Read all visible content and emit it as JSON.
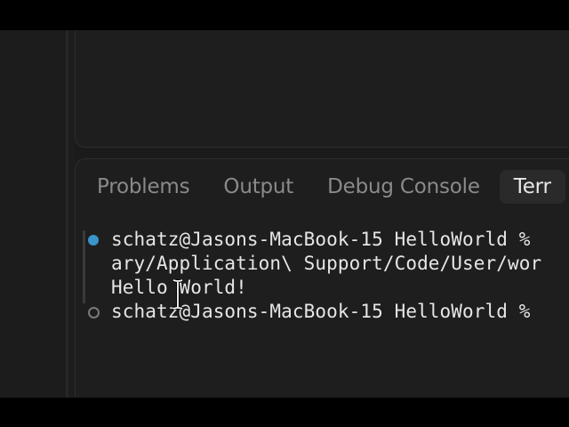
{
  "panel": {
    "tabs": [
      {
        "label": "Problems"
      },
      {
        "label": "Output"
      },
      {
        "label": "Debug Console"
      },
      {
        "label": "Terr"
      }
    ]
  },
  "terminal": {
    "lines": [
      {
        "text": "schatz@Jasons-MacBook-15 HelloWorld % ",
        "status": "success"
      },
      {
        "text": "ary/Application\\ Support/Code/User/wor"
      },
      {
        "text": "Hello World!"
      },
      {
        "text": "schatz@Jasons-MacBook-15 HelloWorld % ",
        "status": "idle"
      }
    ]
  },
  "colors": {
    "accent_dot": "#3a93c9",
    "background": "#1e1e1e"
  }
}
